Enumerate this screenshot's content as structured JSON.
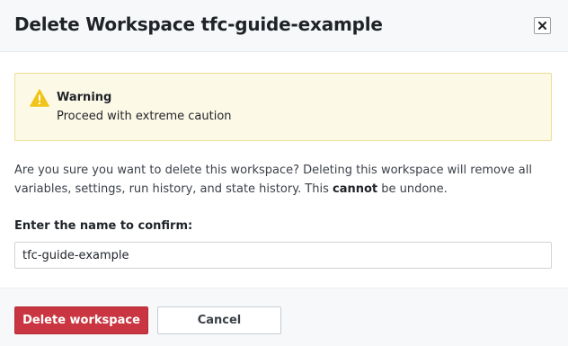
{
  "modal": {
    "title": "Delete Workspace tfc-guide-example",
    "close_icon": "close-icon"
  },
  "warning": {
    "icon": "warning-triangle-icon",
    "title": "Warning",
    "text": "Proceed with extreme caution",
    "bg_color": "#fdf9e7",
    "icon_color": "#f0c419"
  },
  "description": {
    "text_before": "Are you sure you want to delete this workspace? Deleting this workspace will remove all variables, settings, run history, and state history. This ",
    "emphasis": "cannot",
    "text_after": " be undone."
  },
  "confirm": {
    "label": "Enter the name to confirm:",
    "value": "tfc-guide-example"
  },
  "footer": {
    "delete_label": "Delete workspace",
    "cancel_label": "Cancel",
    "delete_color": "#c93540"
  }
}
